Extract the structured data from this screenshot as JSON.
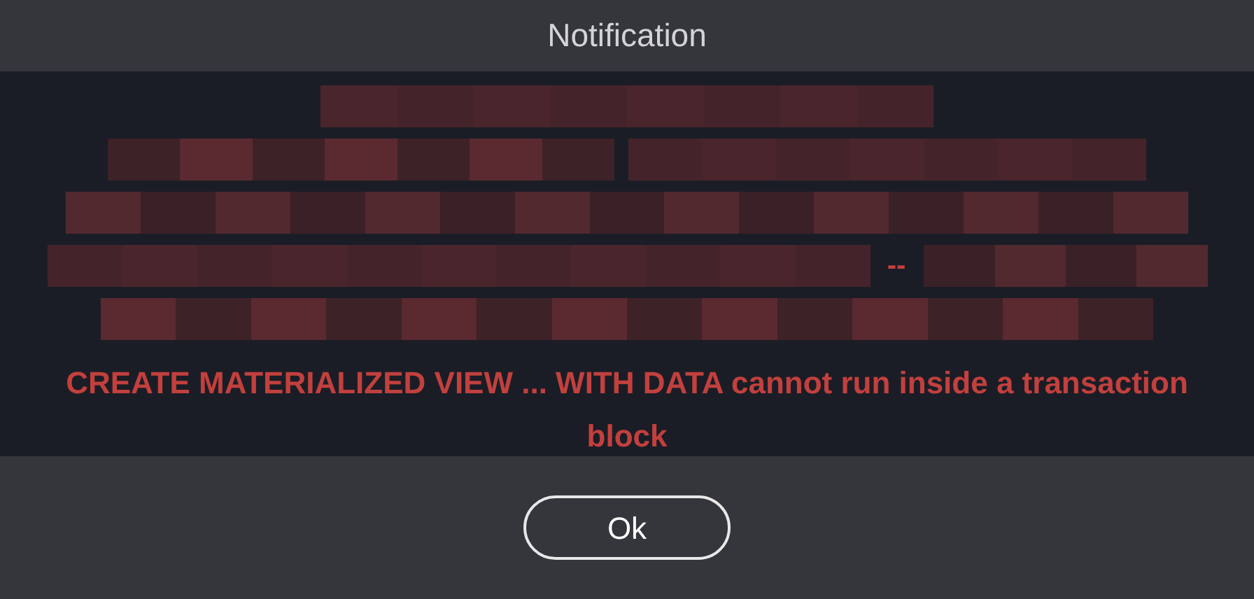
{
  "window": {
    "title": "Notification"
  },
  "message": {
    "separator": "--",
    "error": "CREATE MATERIALIZED VIEW ... WITH DATA cannot run inside a transaction block"
  },
  "buttons": [
    {
      "label": "Ok"
    }
  ]
}
